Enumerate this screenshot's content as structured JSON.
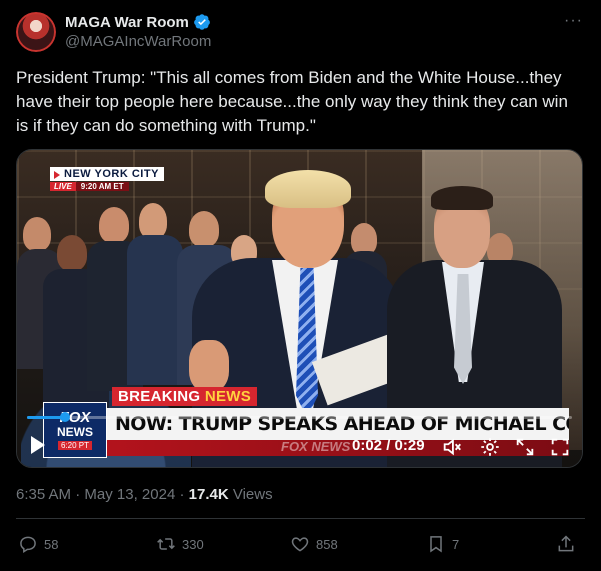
{
  "author": {
    "display_name": "MAGA War Room",
    "handle": "@MAGAIncWarRoom",
    "verified": true,
    "more_icon": "more-horizontal-icon"
  },
  "tweet": {
    "text": "President Trump: \"This all comes from Biden and the White House...they have their top people here because...the only way they think they can win is if they can do something with Trump.\""
  },
  "video": {
    "location_bug": {
      "city": "NEW YORK CITY",
      "live": "LIVE",
      "time": "9:20 AM ET"
    },
    "lower_third": {
      "breaking": "BREAKING",
      "news": "NEWS",
      "headline": "NOW: TRUMP SPEAKS AHEAD OF MICHAEL COHEN TESTIMONY",
      "logo_line1": "FOX",
      "logo_line2": "NEWS",
      "logo_time": "6:20 PT",
      "watermark": "FOX NEWS"
    },
    "player": {
      "timecode": "0:02 / 0:29",
      "progress": 0.07,
      "play_icon": "play-icon",
      "mute_icon": "muted-speaker-icon",
      "settings_icon": "gear-icon",
      "fullscreen_icon": "fullscreen-icon",
      "popout_icon": "popout-icon"
    }
  },
  "meta": {
    "time": "6:35 AM",
    "separator": "·",
    "date": "May 13, 2024",
    "separator2": "·",
    "views_count": "17.4K",
    "views_label": "Views"
  },
  "actions": {
    "replies": "58",
    "reposts": "330",
    "likes": "858",
    "bookmarks": "7"
  },
  "colors": {
    "background": "#000000",
    "text": "#e7e9ea",
    "muted": "#71767b",
    "accent": "#1d9bf0",
    "fox_red": "#d6262f",
    "fox_blue": "#0d2a66"
  }
}
